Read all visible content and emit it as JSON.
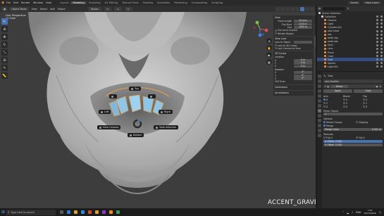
{
  "menubar": {
    "menus": [
      "File",
      "Edit",
      "Render",
      "Window",
      "Help"
    ],
    "workspaces": [
      "Layout",
      "Modeling",
      "Sculpting",
      "UV Editing",
      "Texture Paint",
      "Shading",
      "Animation",
      "Rendering",
      "Compositing",
      "Scripting"
    ],
    "active_workspace": "Modeling",
    "scene": "Scene",
    "view_layer": "View Layer"
  },
  "viewport_header": {
    "mode": "Object Mode",
    "menus": [
      "View",
      "Select",
      "Add",
      "Object"
    ],
    "orientation": "Global",
    "info_line1": "User Perspective",
    "info_line2": "(1) Tube"
  },
  "npanel": {
    "view_title": "View",
    "focal_length_label": "Focal Length",
    "focal_length": "50 mm",
    "clip_start_label": "Clip Start",
    "clip_start": "0.01 m",
    "clip_end_label": "End",
    "clip_end": "1000 m",
    "local_camera": "Use Local Camera",
    "render_region": "Render Region",
    "view_lock_title": "View Lock",
    "lock_to_object": "Lock to Object",
    "lock_to_3d_cursor": "Lock to 3D Cursor",
    "lock_camera_to_view": "Lock Camera to View",
    "cursor_title": "3D Cursor",
    "location_label": "Location",
    "loc_x": "0 m",
    "loc_y": "0 m",
    "loc_z": "0 m",
    "rotation_label": "Rotation",
    "rot_x": "0°",
    "rot_y": "0°",
    "rot_z": "0°",
    "rot_mode": "XYZ Euler",
    "collections_title": "Collections",
    "annotations_title": "Annotations"
  },
  "pie_menu": {
    "top": "Top",
    "left": "Left",
    "right": "Right",
    "bottom": "Bottom",
    "front": "Front",
    "view_camera": "View Camera",
    "view_selected": "View Selected"
  },
  "screencast_key": "ACCENT_GRAVE",
  "outliner": {
    "rows": [
      {
        "label": "Scene Collection",
        "color": "#cfcfcf",
        "depth": 0,
        "selected": false
      },
      {
        "label": "Collection",
        "color": "#cfcfcf",
        "depth": 1,
        "selected": false
      },
      {
        "label": "Camera",
        "color": "#e08f4a",
        "depth": 2,
        "selected": false
      },
      {
        "label": "Light",
        "color": "#e08f4a",
        "depth": 2,
        "selected": false
      },
      {
        "label": "Cylinder.001",
        "color": "#e08f4a",
        "depth": 2,
        "selected": false
      },
      {
        "label": "skull.head",
        "color": "#e08f4a",
        "depth": 2,
        "selected": false
      },
      {
        "label": "jaw",
        "color": "#e08f4a",
        "depth": 2,
        "selected": false
      },
      {
        "label": "teeth.top",
        "color": "#e08f4a",
        "depth": 2,
        "selected": false
      },
      {
        "label": "teeth.bot",
        "color": "#e08f4a",
        "depth": 2,
        "selected": false
      },
      {
        "label": "Eyes",
        "color": "#e08f4a",
        "depth": 2,
        "selected": false
      },
      {
        "label": "Lens",
        "color": "#e08f4a",
        "depth": 2,
        "selected": false
      },
      {
        "label": "Plane",
        "color": "#e08f4a",
        "depth": 2,
        "selected": false
      },
      {
        "label": "Cube",
        "color": "#e08f4a",
        "depth": 2,
        "selected": false
      },
      {
        "label": "Tube",
        "color": "#e08f4a",
        "depth": 2,
        "selected": true
      },
      {
        "label": "Sphere",
        "color": "#e08f4a",
        "depth": 2,
        "selected": false
      },
      {
        "label": "Light.001",
        "color": "#e08f4a",
        "depth": 2,
        "selected": false
      }
    ]
  },
  "properties": {
    "object": "Tube",
    "modifier_btn": "Add Modifier",
    "mirror": "Mirror",
    "apply": "Apply",
    "copy": "Copy",
    "axis_label": "Axis",
    "bisect_label": "Bisect",
    "flip_label": "Flip",
    "x": "X",
    "y": "Y",
    "z": "Z",
    "mirror_object_label": "Mirror Object:",
    "options_label": "Options:",
    "vertex_groups": "Vertex Groups",
    "clipping": "Clipping",
    "merge": "Merge",
    "merge_limit_label": "Merge Limit:",
    "merge_limit": "0.001 m",
    "textures_label": "Textures:",
    "flip_u": "Flip U",
    "flip_v": "Flip V",
    "u_offset": "U Offset: 0.000",
    "v_offset": "V Offset: 0.000"
  },
  "taskbar": {
    "search_placeholder": "Type here to search",
    "lang": "ENG",
    "time": "7:51",
    "date": "10/27/2020"
  },
  "colors": {
    "accent": "#4772b3",
    "mesh": "#bdbdbd",
    "highlight_blue": "#8fc6e8",
    "highlight_orange": "#e3a04b"
  }
}
